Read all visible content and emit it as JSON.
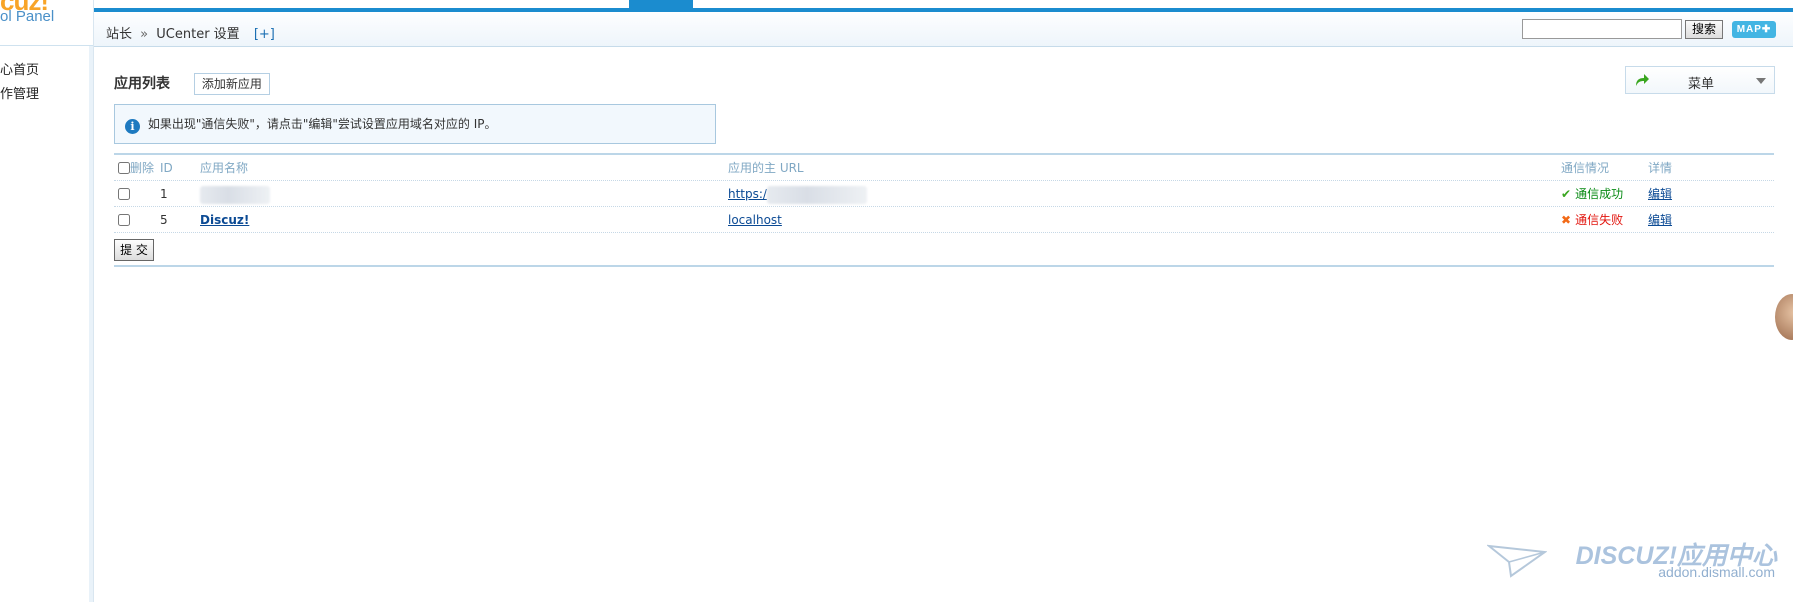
{
  "sidebar": {
    "logo_text": "cuz!",
    "logo_sub": "ol Panel",
    "items": [
      {
        "label": "心首页"
      },
      {
        "label": "作管理"
      }
    ]
  },
  "breadcrumb": {
    "root": "站长",
    "separator": "»",
    "current": "UCenter 设置",
    "add_shortcut": "[+]"
  },
  "search": {
    "value": "",
    "button_label": "搜索",
    "map_label": "MAP"
  },
  "page": {
    "title": "应用列表",
    "add_button": "添加新应用",
    "menu_label": "菜单",
    "tip": "如果出现\"通信失败\"，请点击\"编辑\"尝试设置应用域名对应的 IP。"
  },
  "table": {
    "headers": {
      "delete": "删除",
      "id": "ID",
      "name": "应用名称",
      "url": "应用的主 URL",
      "status": "通信情况",
      "detail": "详情"
    },
    "rows": [
      {
        "id": "1",
        "name": "",
        "url": "https:/",
        "status": "通信成功",
        "status_type": "success",
        "detail": "编辑"
      },
      {
        "id": "5",
        "name": "Discuz!",
        "url": "localhost",
        "status": "通信失败",
        "status_type": "fail",
        "detail": "编辑"
      }
    ],
    "submit_label": "提 交"
  },
  "watermark": {
    "brand": "DISCUZ!应用中心",
    "site": "addon.dismall.com"
  },
  "colors": {
    "accent": "#1b8ccf",
    "success": "#098b15",
    "fail": "#e2160f",
    "logo": "#f8a427"
  }
}
